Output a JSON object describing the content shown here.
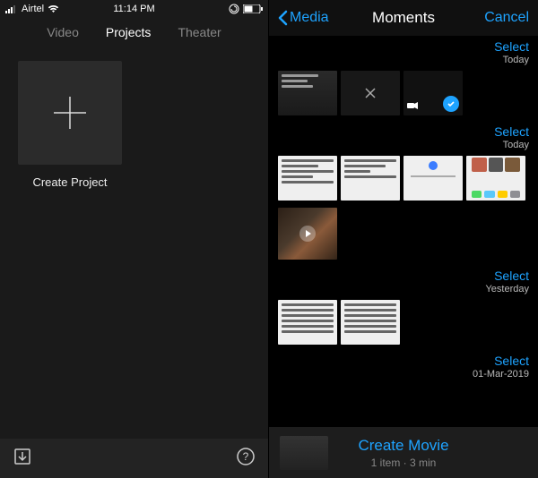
{
  "status": {
    "carrier": "Airtel",
    "time": "11:14 PM"
  },
  "left": {
    "tabs": {
      "video": "Video",
      "projects": "Projects",
      "theater": "Theater"
    },
    "create_label": "Create Project"
  },
  "right": {
    "back_label": "Media",
    "title": "Moments",
    "cancel": "Cancel",
    "sections": [
      {
        "select": "Select",
        "date": "Today"
      },
      {
        "select": "Select",
        "date": "Today"
      },
      {
        "select": "Select",
        "date": "Yesterday"
      },
      {
        "select": "Select",
        "date": "01-Mar-2019"
      }
    ],
    "create_movie": {
      "title": "Create Movie",
      "subtitle": "1 item · 3 min"
    }
  }
}
